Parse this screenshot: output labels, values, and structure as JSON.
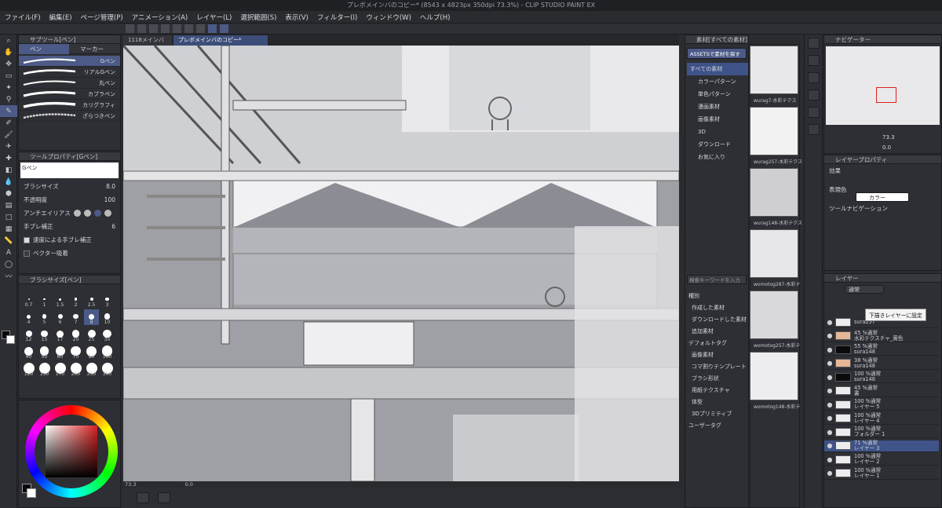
{
  "window": {
    "title": "プレボメインバのコピー* (8543 x 4823px 350dpi 73.3%) - CLIP STUDIO PAINT EX"
  },
  "menu": [
    "ファイル(F)",
    "編集(E)",
    "ページ管理(P)",
    "アニメーション(A)",
    "レイヤー(L)",
    "選択範囲(S)",
    "表示(V)",
    "フィルター(I)",
    "ウィンドウ(W)",
    "ヘルプ(H)"
  ],
  "tabs": [
    "1118メインバー",
    "プレボメインバのコピー*"
  ],
  "sub_tool": {
    "title": "サブツール[ペン]",
    "tabs": [
      "ペン",
      "マーカー"
    ],
    "brushes": [
      "Gペン",
      "リアルGペン",
      "丸ペン",
      "カブラペン",
      "カリグラフィ",
      "ざらつきペン"
    ]
  },
  "tool_property": {
    "title": "ツールプロパティ[Gペン]",
    "brush_name": "Gペン",
    "size_label": "ブラシサイズ",
    "size_value": "8.0",
    "opacity_label": "不透明度",
    "opacity_value": "100",
    "aa_label": "アンチエイリアス",
    "stab_label": "手ブレ補正",
    "stab_value": "6",
    "speed_label": "速度による手ブレ補正",
    "vector_label": "ベクター吸着"
  },
  "brush_size": {
    "title": "ブラシサイズ[ペン]",
    "values": [
      "0.7",
      "1",
      "1.5",
      "2",
      "2.5",
      "3",
      "4",
      "5",
      "6",
      "7",
      "8",
      "10",
      "12",
      "15",
      "17",
      "20",
      "25",
      "30",
      "40",
      "50",
      "60",
      "70",
      "80",
      "100",
      "120",
      "150",
      "170",
      "200",
      "250",
      "300"
    ]
  },
  "canvas": {
    "zoom": "73.3",
    "angle": "0.0"
  },
  "material": {
    "title": "素材[すべての素材]",
    "assets_button": "ASSETSで素材を探す",
    "tree": [
      "すべての素材",
      "カラーパターン",
      "単色パターン",
      "漫画素材",
      "画像素材",
      "3D",
      "ダウンロード",
      "お気に入り"
    ],
    "search_placeholder": "検索キーワードを入力",
    "tag_header": "種別",
    "tags": [
      "作成した素材",
      "ダウンロードした素材",
      "追加素材"
    ],
    "tag_header2": "デフォルトタグ",
    "tags2": [
      "画像素材",
      "コマ割りテンプレート",
      "ブラシ形状",
      "用紙テクスチャ",
      "体型",
      "3Dプリミティブ"
    ],
    "tag_more": "ユーザータグ",
    "items": [
      "wurag7-水彩テクス",
      "wurag257-水彩テクス",
      "wurag148-水彩テクス",
      "womotog287-水彩テ",
      "womotog257-水彩テ",
      "womotog148-水彩テ"
    ]
  },
  "navigator": {
    "title": "ナビゲーター",
    "zoom": "73.3",
    "angle": "0.0"
  },
  "layer_property": {
    "title": "レイヤープロパティ",
    "effect_label": "効果",
    "color_label": "表現色",
    "color_value": "カラー",
    "toolnav_label": "ツールナビゲーション"
  },
  "layers": {
    "title": "レイヤー",
    "blend": "通常",
    "tooltip": "下描きレイヤーに設定",
    "rows": [
      {
        "pct": "",
        "name": "sura257"
      },
      {
        "pct": "45 %通常",
        "name": "水彩テクスチャ_黄色"
      },
      {
        "pct": "55 %通常",
        "name": "sura148"
      },
      {
        "pct": "38 %通常",
        "name": "sura148"
      },
      {
        "pct": "100 %通常",
        "name": "sura148"
      },
      {
        "pct": "45 %通常",
        "name": "書"
      },
      {
        "pct": "100 %通常",
        "name": "レイヤー 5"
      },
      {
        "pct": "100 %通常",
        "name": "レイヤー 4"
      },
      {
        "pct": "100 %通常",
        "name": "フォルダー 1"
      },
      {
        "pct": "71 %通常",
        "name": "レイヤー 3"
      },
      {
        "pct": "100 %通常",
        "name": "レイヤー 2"
      },
      {
        "pct": "100 %通常",
        "name": "レイヤー 1"
      }
    ]
  },
  "colors": {
    "accent": "#4b5a86",
    "selected_layer": "#3f5388",
    "fg": "#0a0a0c",
    "bg": "#ffffff"
  }
}
